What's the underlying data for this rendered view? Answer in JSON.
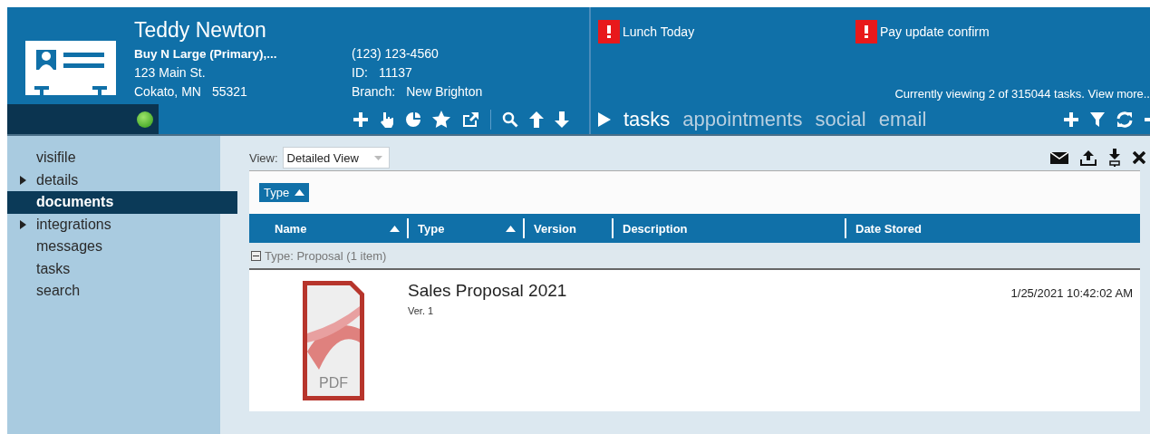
{
  "contact": {
    "name": "Teddy Newton",
    "company": "Buy N Large (Primary),...",
    "address": "123 Main St.",
    "city": "Cokato, MN",
    "zip": "55321",
    "phone": "(123) 123-4560",
    "id_label": "ID:",
    "id": "11137",
    "branch_label": "Branch:",
    "branch": "New Brighton",
    "online": true
  },
  "alerts": [
    {
      "text": "Lunch Today"
    },
    {
      "text": "Pay update confirm"
    }
  ],
  "task_summary": "Currently viewing 2 of 315044 tasks. View more..",
  "feed_tabs": [
    {
      "label": "tasks",
      "selected": true
    },
    {
      "label": "appointments",
      "selected": false
    },
    {
      "label": "social",
      "selected": false
    },
    {
      "label": "email",
      "selected": false
    }
  ],
  "sidebar": {
    "items": [
      {
        "label": "visifile",
        "kind": "plain",
        "selected": false
      },
      {
        "label": "details",
        "kind": "expandable",
        "selected": false
      },
      {
        "label": "documents",
        "kind": "plain",
        "selected": true
      },
      {
        "label": "integrations",
        "kind": "expandable",
        "selected": false
      },
      {
        "label": "messages",
        "kind": "plain",
        "selected": false
      },
      {
        "label": "tasks",
        "kind": "plain",
        "selected": false
      },
      {
        "label": "search",
        "kind": "plain",
        "selected": false
      }
    ]
  },
  "view": {
    "label": "View:",
    "value": "Detailed View"
  },
  "grouping": {
    "chip": "Type"
  },
  "table": {
    "columns": [
      {
        "label": "Name",
        "sorted": true
      },
      {
        "label": "Type",
        "sorted": true
      },
      {
        "label": "Version",
        "sorted": false
      },
      {
        "label": "Description",
        "sorted": false
      },
      {
        "label": "Date Stored",
        "sorted": false
      }
    ],
    "groups": [
      {
        "label": "Type: Proposal (1 item)",
        "expanded": true,
        "rows": [
          {
            "name": "Sales Proposal 2021",
            "version": "Ver. 1",
            "date": "1/25/2021 10:42:02 AM",
            "file_label": "PDF"
          }
        ]
      }
    ]
  }
}
